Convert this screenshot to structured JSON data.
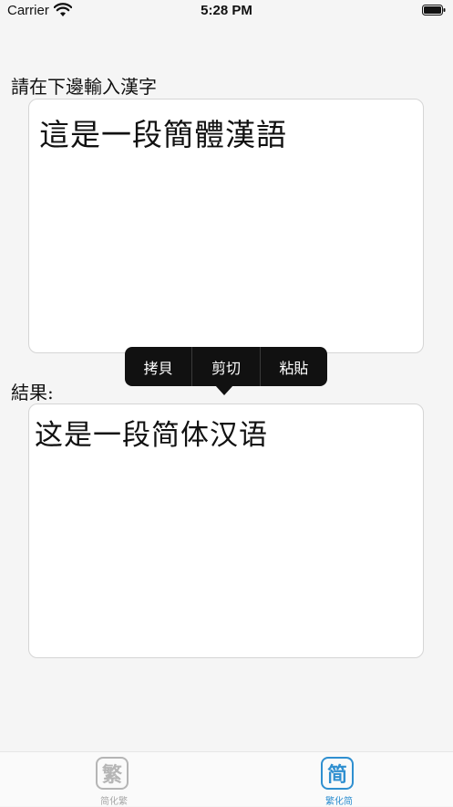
{
  "status_bar": {
    "carrier": "Carrier",
    "time": "5:28 PM"
  },
  "input": {
    "label": "請在下邊輸入漢字",
    "value": "這是一段簡體漢語"
  },
  "result": {
    "label": "結果:",
    "value": "这是一段简体汉语"
  },
  "context_menu": {
    "items": [
      "拷貝",
      "剪切",
      "粘貼"
    ]
  },
  "tab_bar": {
    "tabs": [
      {
        "icon_char": "繁",
        "label": "简化繁",
        "selected": false
      },
      {
        "icon_char": "简",
        "label": "繁化简",
        "selected": true
      }
    ]
  },
  "colors": {
    "accent": "#2f8fd0",
    "inactive": "#b5b5b5",
    "menu_bg": "#111111"
  }
}
